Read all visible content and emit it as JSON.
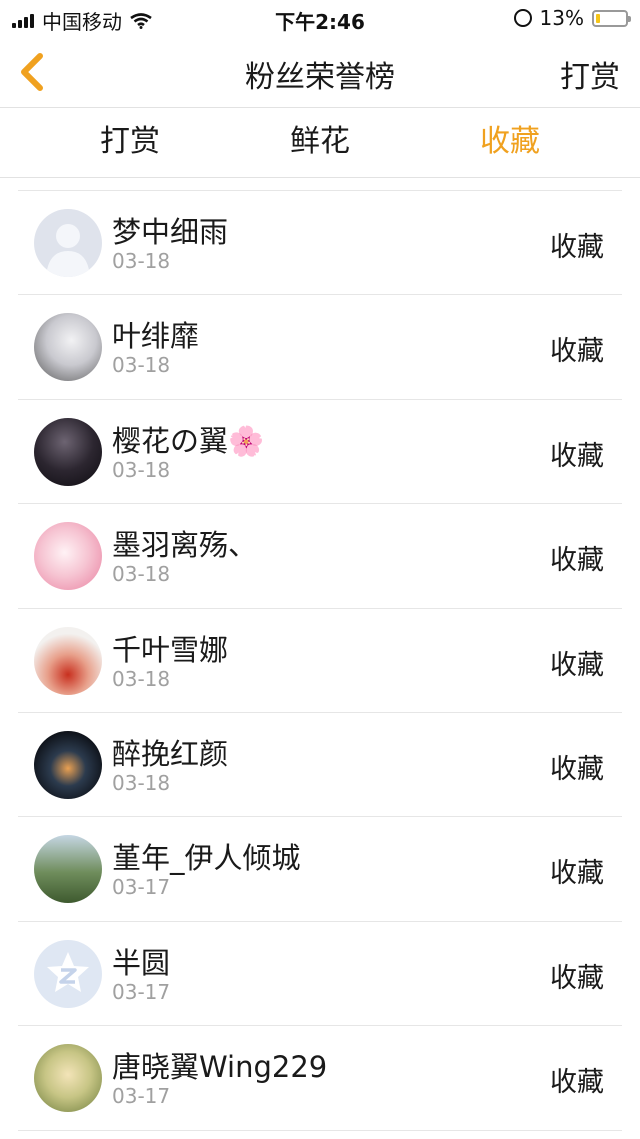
{
  "status_bar": {
    "carrier": "中国移动",
    "time": "下午2:46",
    "battery": "13%",
    "battery_level": 0.13
  },
  "nav": {
    "title": "粉丝荣誉榜",
    "action_label": "打赏",
    "back_icon": "chevron-left-icon"
  },
  "tabs": [
    {
      "label": "打赏",
      "active": false
    },
    {
      "label": "鲜花",
      "active": false
    },
    {
      "label": "收藏",
      "active": true
    }
  ],
  "colors": {
    "accent": "#f0a11f",
    "divider": "#e6e6e6",
    "date_text": "#a0a0a0"
  },
  "list": [
    {
      "name": "梦中细雨",
      "date": "03-18",
      "action": "收藏",
      "avatar": "default-avatar"
    },
    {
      "name": "叶绯靡",
      "date": "03-18",
      "action": "收藏",
      "avatar": "anime-girl-avatar"
    },
    {
      "name": "樱花の翼🌸",
      "date": "03-18",
      "action": "收藏",
      "avatar": "dark-figure-avatar"
    },
    {
      "name": "墨羽离殇、",
      "date": "03-18",
      "action": "收藏",
      "avatar": "pink-anime-avatar"
    },
    {
      "name": "千叶雪娜",
      "date": "03-18",
      "action": "收藏",
      "avatar": "red-dress-avatar"
    },
    {
      "name": "醉挽红颜",
      "date": "03-18",
      "action": "收藏",
      "avatar": "night-sky-avatar"
    },
    {
      "name": "堇年_伊人倾城",
      "date": "03-17",
      "action": "收藏",
      "avatar": "field-girl-avatar"
    },
    {
      "name": "半圆",
      "date": "03-17",
      "action": "收藏",
      "avatar": "qq-default-avatar"
    },
    {
      "name": "唐晓翼Wing229",
      "date": "03-17",
      "action": "收藏",
      "avatar": "anime-boy-avatar"
    }
  ]
}
